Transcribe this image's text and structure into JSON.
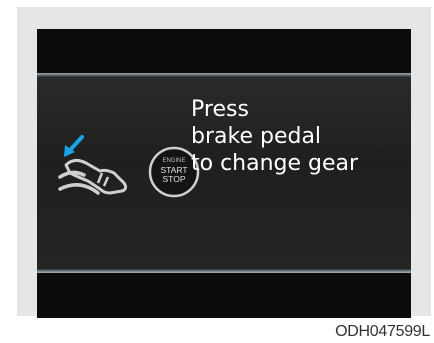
{
  "message": {
    "line1": "Press",
    "line2": "brake pedal",
    "line3": "to change gear"
  },
  "start_button": {
    "top": "ENGINE",
    "middle": "START",
    "bottom": "STOP"
  },
  "image_code": "ODH047599L",
  "icons": {
    "foot": "brake-pedal-foot-icon",
    "arrow": "press-arrow-icon",
    "button": "engine-start-stop-button-icon"
  },
  "colors": {
    "background_dark": "#0c0c0c",
    "band": "#1f1f1f",
    "arrow_blue": "#1aa3e8",
    "text": "#ffffff"
  }
}
